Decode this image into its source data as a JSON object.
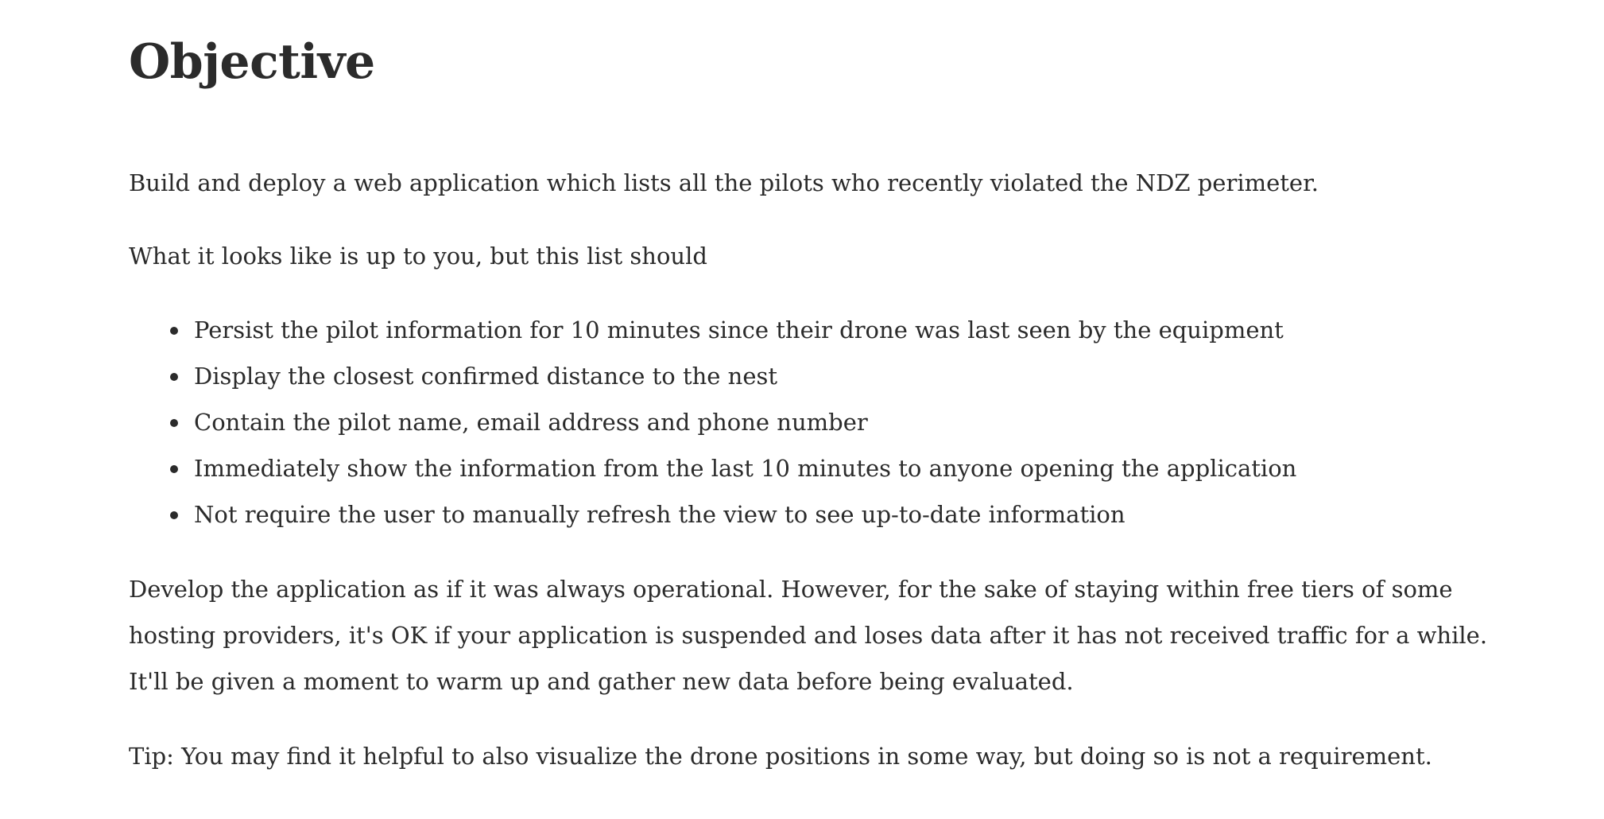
{
  "heading": "Objective",
  "intro": "Build and deploy a web application which lists all the pilots who recently violated the NDZ perimeter.",
  "lead": "What it looks like is up to you, but this list should",
  "requirements": [
    "Persist the pilot information for 10 minutes since their drone was last seen by the equipment",
    "Display the closest confirmed distance to the nest",
    "Contain the pilot name, email address and phone number",
    "Immediately show the information from the last 10 minutes to anyone opening the application",
    "Not require the user to manually refresh the view to see up-to-date information"
  ],
  "develop": "Develop the application as if it was always operational. However, for the sake of staying within free tiers of some hosting providers, it's OK if your application is suspended and loses data after it has not received traffic for a while. It'll be given a moment to warm up and gather new data before being evaluated.",
  "tip": "Tip: You may find it helpful to also visualize the drone positions in some way, but doing so is not a requirement."
}
